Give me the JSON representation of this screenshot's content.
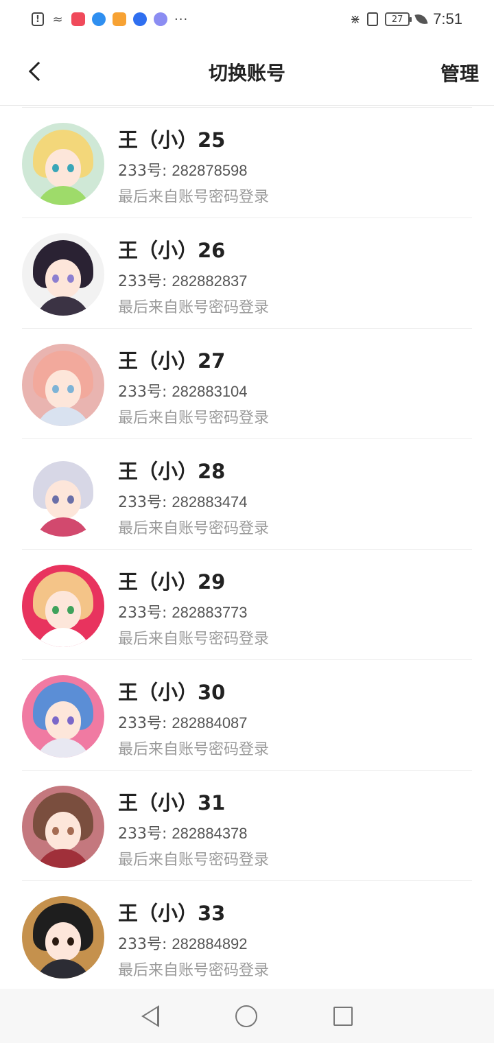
{
  "status_bar": {
    "time": "7:51",
    "battery": "27",
    "app_icons": [
      "alert-icon",
      "wifi-icon",
      "xiaohongshu-icon",
      "location-icon",
      "video-icon",
      "baidu-icon",
      "music-icon"
    ],
    "more": "···"
  },
  "header": {
    "title": "切换账号",
    "manage_label": "管理"
  },
  "accounts": [
    {
      "name": "王（小）25",
      "id_label": "233号: ",
      "id_value": "282878598",
      "login": "最后来自账号密码登录",
      "bg": "#cfe8d6",
      "hair": "#f3d77a",
      "body": "#9edb6a",
      "eye": "#3aa6b8"
    },
    {
      "name": "王（小）26",
      "id_label": "233号: ",
      "id_value": "282882837",
      "login": "最后来自账号密码登录",
      "bg": "#f2f2f2",
      "hair": "#2a2233",
      "body": "#3b3344",
      "eye": "#8c7fd0"
    },
    {
      "name": "王（小）27",
      "id_label": "233号: ",
      "id_value": "282883104",
      "login": "最后来自账号密码登录",
      "bg": "#e9b4b0",
      "hair": "#f2a99c",
      "body": "#d9e2f0",
      "eye": "#7db3d6"
    },
    {
      "name": "王（小）28",
      "id_label": "233号: ",
      "id_value": "282883474",
      "login": "最后来自账号密码登录",
      "bg": "#ffffff",
      "hair": "#d7d7e6",
      "body": "#d2496e",
      "eye": "#6a6fa8"
    },
    {
      "name": "王（小）29",
      "id_label": "233号: ",
      "id_value": "282883773",
      "login": "最后来自账号密码登录",
      "bg": "#e8335e",
      "hair": "#f4c488",
      "body": "#ffffff",
      "eye": "#3fa25b"
    },
    {
      "name": "王（小）30",
      "id_label": "233号: ",
      "id_value": "282884087",
      "login": "最后来自账号密码登录",
      "bg": "#f07aa2",
      "hair": "#5b8ed6",
      "body": "#e8e8f2",
      "eye": "#7a67c9"
    },
    {
      "name": "王（小）31",
      "id_label": "233号: ",
      "id_value": "282884378",
      "login": "最后来自账号密码登录",
      "bg": "#c4787e",
      "hair": "#7a4e3e",
      "body": "#a0303a",
      "eye": "#a56b52"
    },
    {
      "name": "王（小）33",
      "id_label": "233号: ",
      "id_value": "282884892",
      "login": "最后来自账号密码登录",
      "bg": "#c5914d",
      "hair": "#1e1e1e",
      "body": "#2c2c34",
      "eye": "#2a1a10"
    }
  ]
}
